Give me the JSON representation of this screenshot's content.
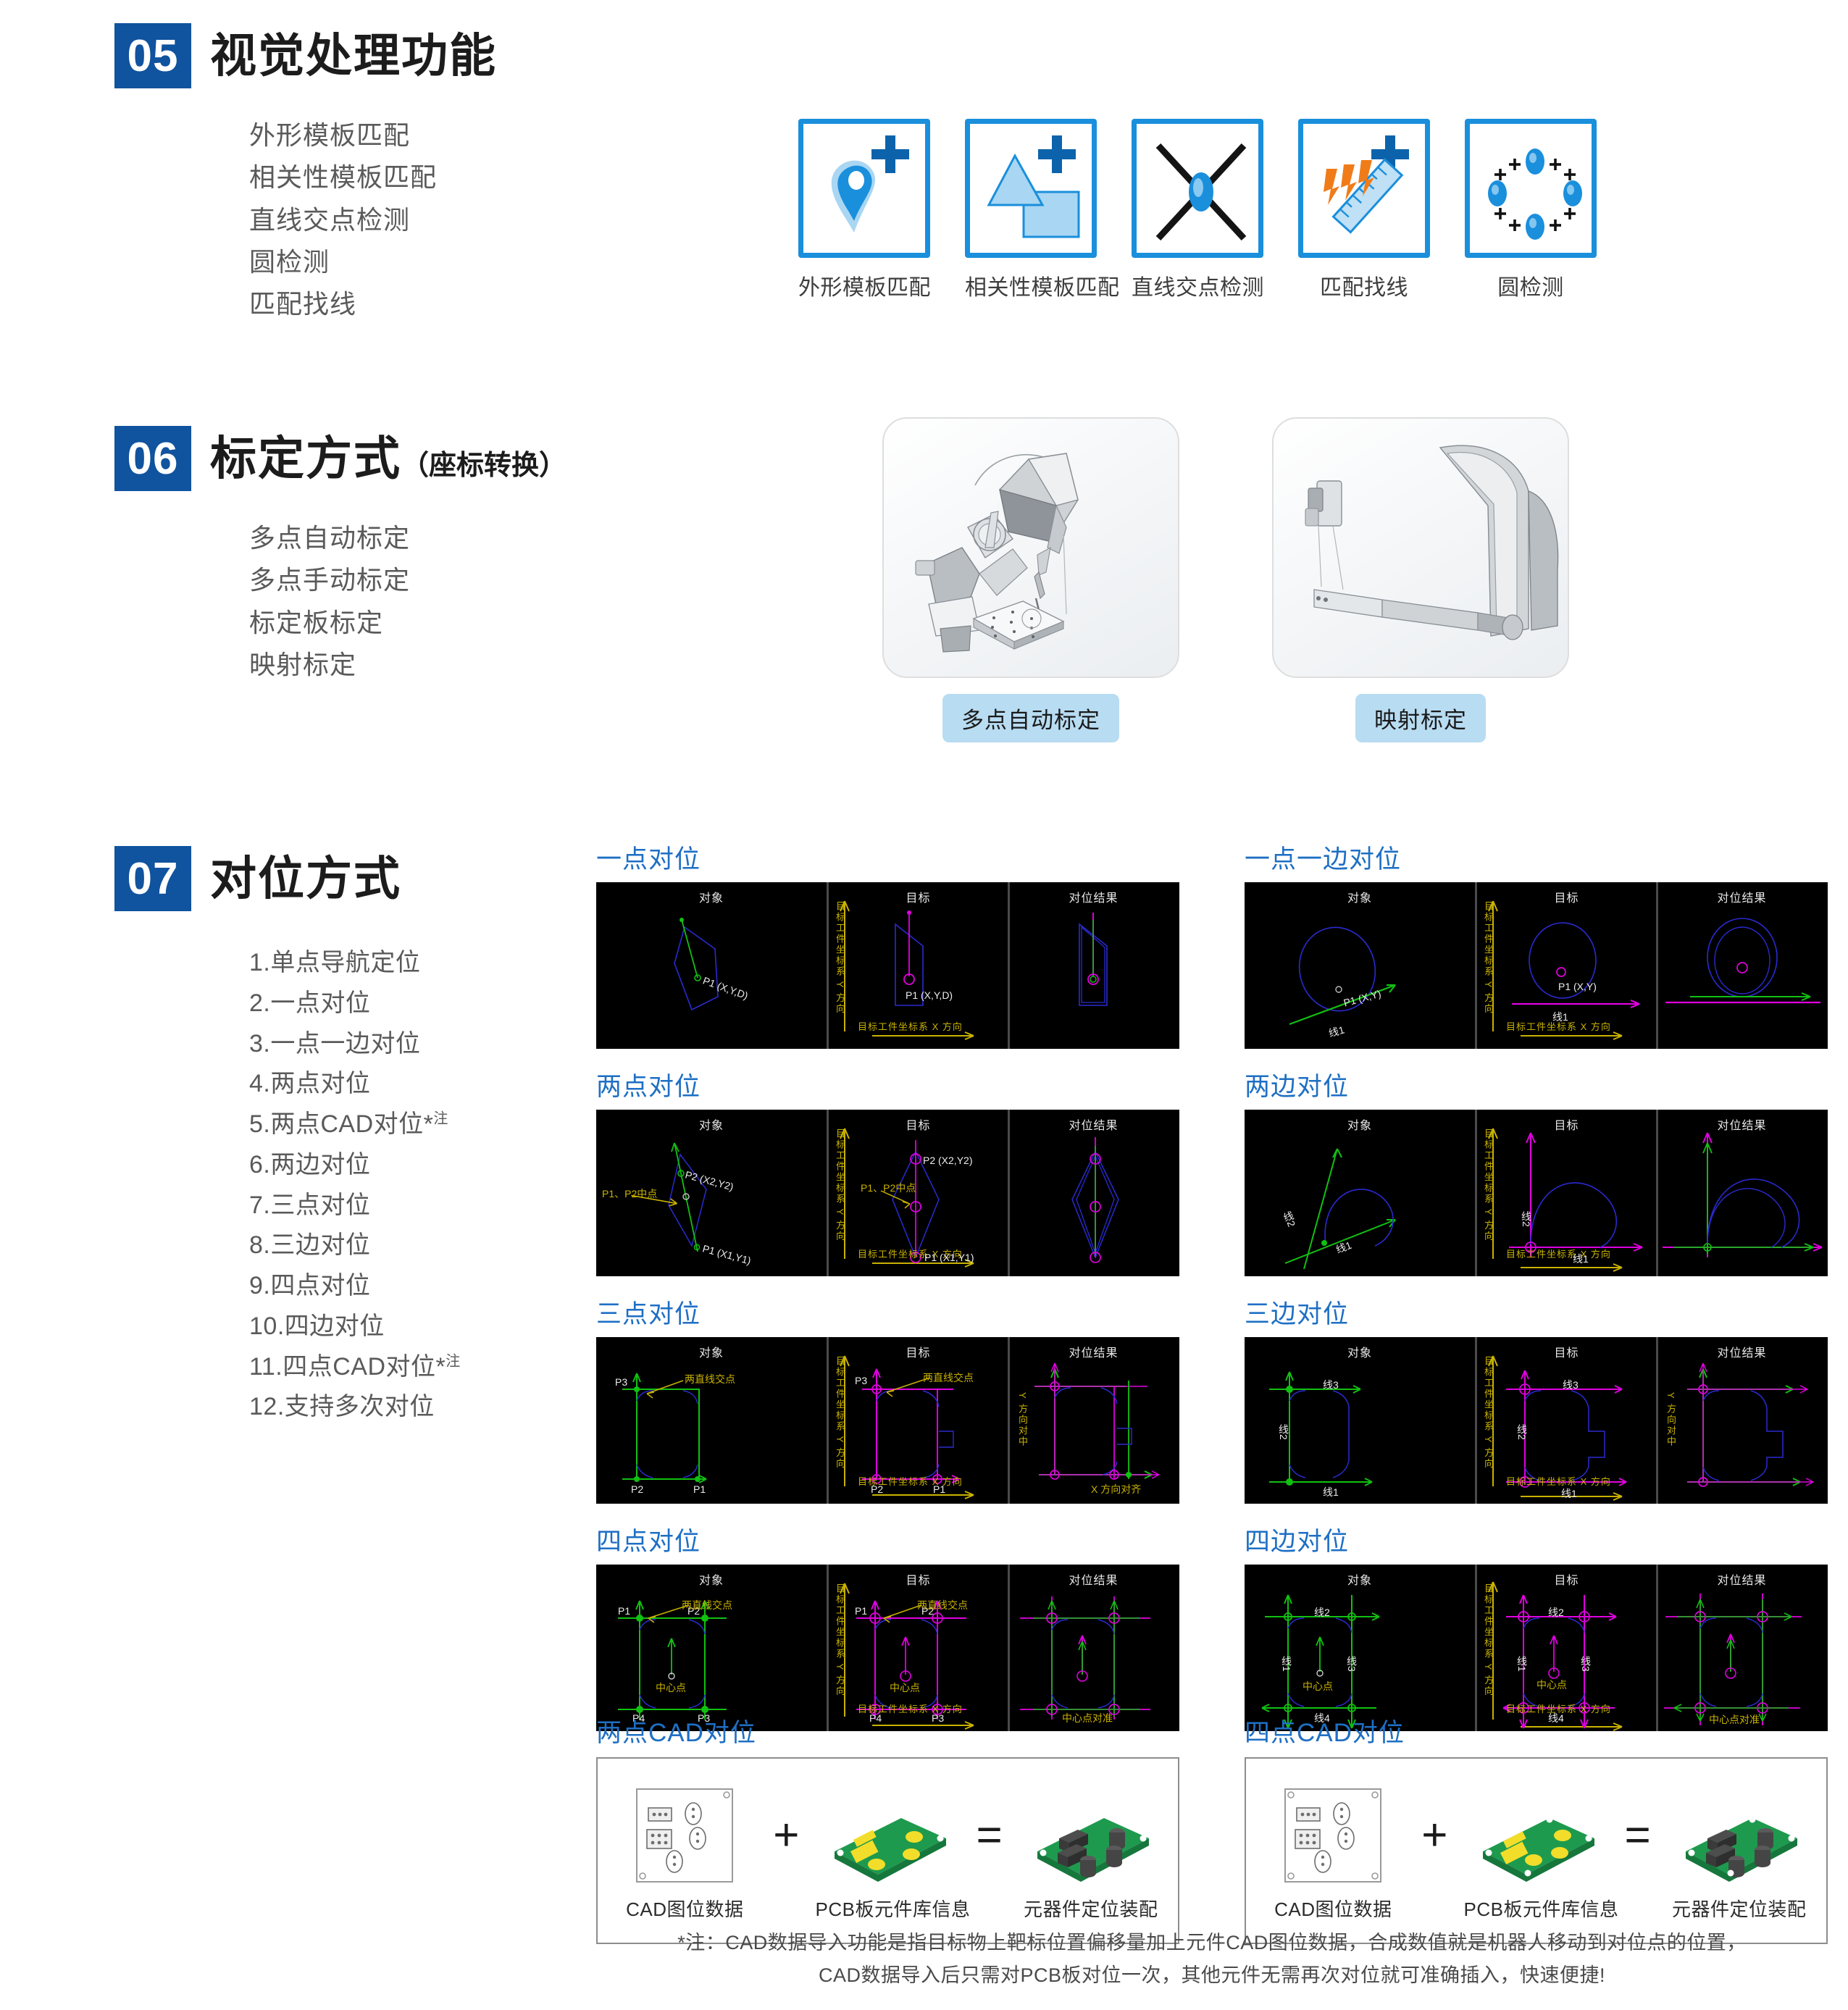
{
  "sections": [
    {
      "number": "05",
      "title": "视觉处理功能",
      "subtitle": "",
      "features": [
        "外形模板匹配",
        "相关性模板匹配",
        "直线交点检测",
        "圆检测",
        "匹配找线"
      ],
      "icons": [
        {
          "caption": "外形模板匹配",
          "icon": "location-pin-icon"
        },
        {
          "caption": "相关性模板匹配",
          "icon": "shapes-overlap-icon"
        },
        {
          "caption": "直线交点检测",
          "icon": "line-cross-icon"
        },
        {
          "caption": "匹配找线",
          "icon": "ruler-scan-icon"
        },
        {
          "caption": "圆检测",
          "icon": "circle-points-icon"
        }
      ]
    },
    {
      "number": "06",
      "title": "标定方式",
      "subtitle": "（座标转换）",
      "features": [
        "多点自动标定",
        "多点手动标定",
        "标定板标定",
        "映射标定"
      ],
      "photos": [
        {
          "caption": "多点自动标定"
        },
        {
          "caption": "映射标定"
        }
      ]
    },
    {
      "number": "07",
      "title": "对位方式",
      "subtitle": "",
      "items": [
        "1.单点导航定位",
        "2.一点对位",
        "3.一点一边对位",
        "4.两点对位",
        "5.两点CAD对位*",
        "6.两边对位",
        "7.三点对位",
        "8.三边对位",
        "9.四点对位",
        "10.四边对位",
        "11.四点CAD对位*",
        "12.支持多次对位"
      ],
      "note_sup": "注"
    }
  ],
  "diagram_common": {
    "pane_object": "对象",
    "pane_target": "目标",
    "pane_result": "对位结果",
    "axis_y": "目标工件坐标系 Y 方向",
    "axis_x": "目标工件坐标系 X 方向"
  },
  "diagrams": [
    {
      "title": "一点对位",
      "labels": {
        "obj": "P1 (X,Y,D)",
        "tgt": "P1 (X,Y,D)"
      }
    },
    {
      "title": "一点一边对位",
      "labels": {
        "obj": "P1 (X,Y)",
        "obj_line": "线1",
        "tgt": "P1 (X,Y)",
        "tgt_line": "线1"
      }
    },
    {
      "title": "两点对位",
      "labels": {
        "mid": "P1、P2中点",
        "p2": "P2 (X2,Y2)",
        "p1": "P1 (X1,Y1)",
        "tgt_mid": "P1、P2中点",
        "tgt_p2": "P2 (X2,Y2)",
        "tgt_p1": "P1 (X1,Y1)"
      }
    },
    {
      "title": "两边对位",
      "labels": {
        "l1": "线1",
        "l2": "线2"
      }
    },
    {
      "title": "三点对位",
      "labels": {
        "cross": "两直线交点",
        "p3": "P3",
        "p2": "P2",
        "p1": "P1",
        "result_y": "Y 方向对中",
        "result_x": "X 方向对齐"
      }
    },
    {
      "title": "三边对位",
      "labels": {
        "l1": "线1",
        "l2": "线2",
        "l3": "线3",
        "result_y": "Y 方向对中"
      }
    },
    {
      "title": "四点对位",
      "labels": {
        "cross": "两直线交点",
        "p1": "P1",
        "p2": "P2",
        "p3": "P3",
        "p4": "P4",
        "center": "中心点",
        "result": "中心点对准"
      }
    },
    {
      "title": "四边对位",
      "labels": {
        "l1": "线1",
        "l2": "线2",
        "l3": "线3",
        "l4": "线4",
        "center": "中心点",
        "result": "中心点对准"
      }
    }
  ],
  "cad_blocks": [
    {
      "title": "两点CAD对位",
      "items": [
        {
          "label": "CAD图位数据",
          "art": "cad-drawing-icon"
        },
        {
          "label": "PCB板元件库信息",
          "art": "pcb-board-icon"
        },
        {
          "label": "元器件定位装配",
          "art": "pcb-assembled-icon"
        }
      ],
      "op1": "+",
      "op2": "="
    },
    {
      "title": "四点CAD对位",
      "items": [
        {
          "label": "CAD图位数据",
          "art": "cad-drawing-icon"
        },
        {
          "label": "PCB板元件库信息",
          "art": "pcb-board-icon"
        },
        {
          "label": "元器件定位装配",
          "art": "pcb-assembled-icon"
        }
      ],
      "op1": "+",
      "op2": "="
    }
  ],
  "footnote": {
    "line1": "*注：CAD数据导入功能是指目标物上靶标位置偏移量加上元件CAD图位数据，合成数值就是机器人移动到对位点的位置，",
    "line2": "CAD数据导入后只需对PCB板对位一次，其他元件无需再次对位就可准确插入，快速便捷!"
  },
  "colors": {
    "brand_blue": "#10539e",
    "icon_blue": "#1a8fdc",
    "title_blue": "#1e6fc4",
    "caption_bg": "#b8dcf2"
  }
}
